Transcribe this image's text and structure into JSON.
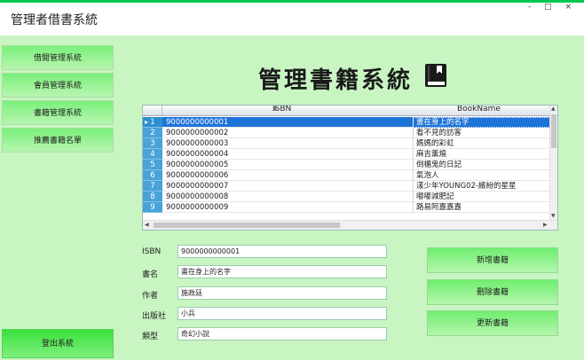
{
  "app": {
    "title": "管理者借書系統",
    "window_controls": "- □ ×"
  },
  "sidebar": {
    "items": [
      {
        "label": "借閱管理系統"
      },
      {
        "label": "會員管理系統"
      },
      {
        "label": "書籍管理系統"
      },
      {
        "label": "推薦書籍名單"
      }
    ],
    "logout_label": "登出系統"
  },
  "main": {
    "heading": "管理書籍系統",
    "heading_icon": "book-icon"
  },
  "grid": {
    "columns": [
      "ISBN",
      "BookName"
    ],
    "sort_indicator": "▲",
    "selected_row": 0,
    "rows": [
      {
        "num": "1",
        "isbn": "9000000000001",
        "name": "畫在身上的名字"
      },
      {
        "num": "2",
        "isbn": "9000000000002",
        "name": "看不見的訪客"
      },
      {
        "num": "3",
        "isbn": "9000000000003",
        "name": "媽媽的彩虹"
      },
      {
        "num": "4",
        "isbn": "9000000000004",
        "name": "麻吉薰燒"
      },
      {
        "num": "5",
        "isbn": "9000000000005",
        "name": "倒楣鬼的日記"
      },
      {
        "num": "6",
        "isbn": "9000000000006",
        "name": "氣泡人"
      },
      {
        "num": "7",
        "isbn": "9000000000007",
        "name": "漾少年YOUNG02-繽紛的星星"
      },
      {
        "num": "8",
        "isbn": "9000000000008",
        "name": "嘟嘟減肥記"
      },
      {
        "num": "9",
        "isbn": "9000000000009",
        "name": "路易阿嘉嘉嘉"
      }
    ]
  },
  "form": {
    "isbn_label": "ISBN",
    "isbn_value": "9000000000001",
    "name_label": "書名",
    "name_value": "畫在身上的名字",
    "author_label": "作者",
    "author_value": "施政廷",
    "publisher_label": "出版社",
    "publisher_value": "小兵",
    "type_label": "類型",
    "type_value": "奇幻小說"
  },
  "actions": {
    "add_label": "新增書籍",
    "delete_label": "刪除書籍",
    "update_label": "更新書籍"
  },
  "colors": {
    "accent": "#00c853",
    "background": "#c8f5c2",
    "selection": "#1e73d8"
  }
}
